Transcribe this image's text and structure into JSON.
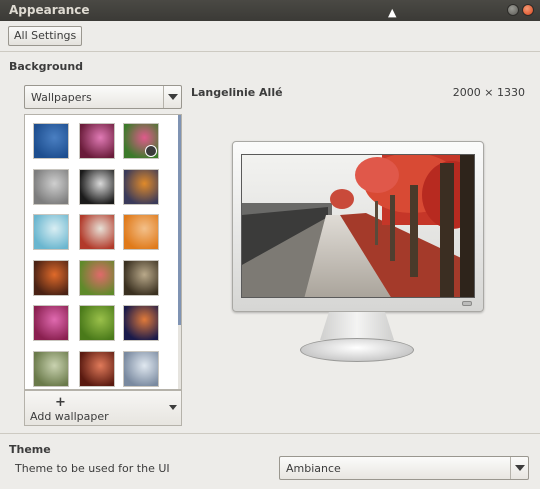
{
  "window": {
    "title": "Appearance"
  },
  "toolbar": {
    "all_settings_label": "All Settings"
  },
  "background": {
    "section_title": "Background",
    "source_select_value": "Wallpapers",
    "add_wallpaper_label": "Add wallpaper",
    "add_wallpaper_symbol": "+",
    "selected_wallpaper": {
      "name": "Langelinie Allé",
      "dimensions": "2000 × 1330"
    },
    "thumbnails": [
      {
        "name": "wallpaper-1",
        "colors": [
          "#1d4e8f",
          "#4a7fc2"
        ]
      },
      {
        "name": "wallpaper-2",
        "colors": [
          "#6a1c3a",
          "#e07ab5"
        ]
      },
      {
        "name": "wallpaper-3",
        "colors": [
          "#3c7a2a",
          "#e05a8c"
        ],
        "slideshow": true
      },
      {
        "name": "wallpaper-4",
        "colors": [
          "#7d7d7d",
          "#cfcfcf"
        ]
      },
      {
        "name": "wallpaper-5",
        "colors": [
          "#1b1b1b",
          "#d9d9d9"
        ]
      },
      {
        "name": "wallpaper-6",
        "colors": [
          "#3a3a5a",
          "#e08a2a"
        ]
      },
      {
        "name": "wallpaper-7",
        "colors": [
          "#6ab6cf",
          "#d9eef3"
        ]
      },
      {
        "name": "wallpaper-8",
        "colors": [
          "#b23a2a",
          "#e7e0d6"
        ]
      },
      {
        "name": "wallpaper-9",
        "colors": [
          "#e07a1a",
          "#f3c08a"
        ]
      },
      {
        "name": "wallpaper-10",
        "colors": [
          "#4a2214",
          "#e06a2a"
        ]
      },
      {
        "name": "wallpaper-11",
        "colors": [
          "#5f8a2a",
          "#e06a6a"
        ]
      },
      {
        "name": "wallpaper-12",
        "colors": [
          "#3a3020",
          "#b9a98a"
        ]
      },
      {
        "name": "wallpaper-13",
        "colors": [
          "#8a2050",
          "#e06ab0"
        ]
      },
      {
        "name": "wallpaper-14",
        "colors": [
          "#4a7a1a",
          "#9ac04a"
        ]
      },
      {
        "name": "wallpaper-15",
        "colors": [
          "#1a1a4a",
          "#e07a3a"
        ]
      },
      {
        "name": "wallpaper-16",
        "colors": [
          "#6a7a4a",
          "#c9d2b0"
        ]
      },
      {
        "name": "wallpaper-17",
        "colors": [
          "#5a1a10",
          "#e07a5a"
        ]
      },
      {
        "name": "wallpaper-18",
        "colors": [
          "#7a8aa0",
          "#e0e8f0"
        ]
      }
    ]
  },
  "theme": {
    "section_title": "Theme",
    "label": "Theme to be used for the UI",
    "select_value": "Ambiance"
  }
}
